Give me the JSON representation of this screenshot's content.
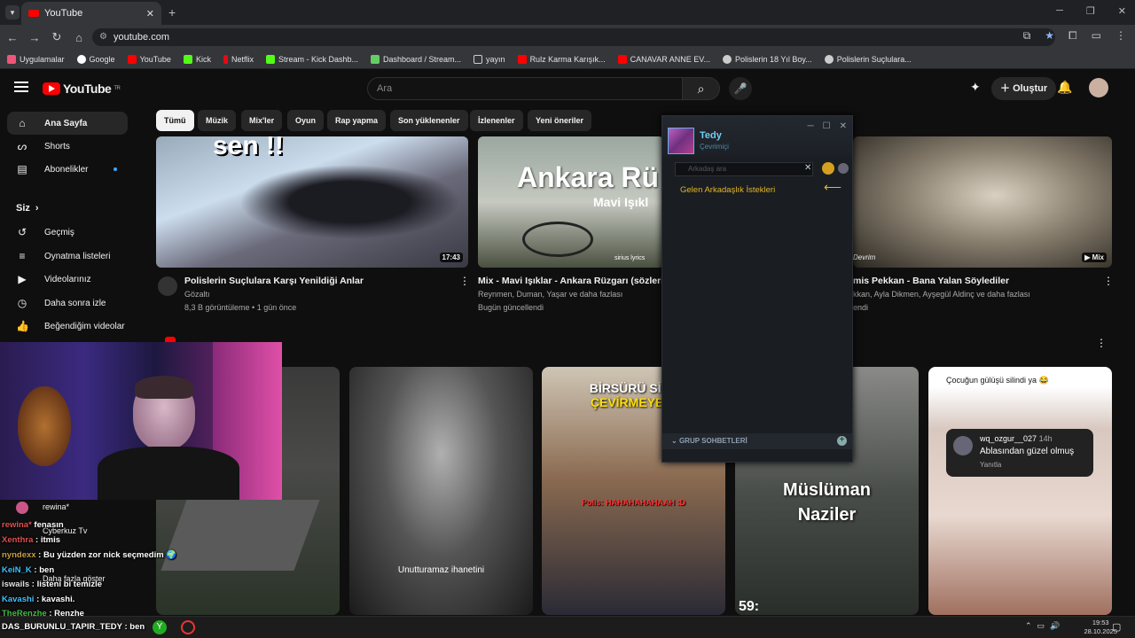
{
  "browser": {
    "tab_title": "YouTube",
    "url": "youtube.com",
    "bookmarks": [
      "Uygulamalar",
      "Google",
      "YouTube",
      "Kick",
      "Netflix",
      "Stream - Kick Dashb...",
      "Dashboard / Stream...",
      "yayın",
      "Rulz Karma Karışık...",
      "CANAVAR ANNE EV...",
      "Polislerin 18 Yıl Boy...",
      "Polislerin Suçlulara..."
    ]
  },
  "youtube": {
    "logo": "YouTube",
    "logo_sup": "TR",
    "search_placeholder": "Ara",
    "create_label": "Oluştur",
    "sidebar": {
      "home": "Ana Sayfa",
      "shorts": "Shorts",
      "subs": "Abonelikler",
      "you": "Siz",
      "history": "Geçmiş",
      "playlists": "Oynatma listeleri",
      "videos": "Videolarınız",
      "watch_later": "Daha sonra izle",
      "liked": "Beğendiğim videolar",
      "sub_channel1": "rewina*",
      "sub_channel2": "Cyberkuz Tv",
      "show_more": "Daha fazla göster"
    },
    "chips": [
      "Tümü",
      "Müzik",
      "Mix'ler",
      "Oyun",
      "Rap yapma",
      "Son yüklenenler",
      "İzlenenler",
      "Yeni öneriler"
    ],
    "videos": [
      {
        "title": "Polislerin Suçlulara Karşı Yenildiği Anlar",
        "channel": "Gözaltı",
        "meta": "8,3 B görüntüleme • 1 gün önce",
        "duration": "17:43",
        "thumb_text": "sen !!"
      },
      {
        "title": "Mix - Mavi Işıklar - Ankara Rüzgarı (sözleri/l",
        "channel": "Reynmen, Duman, Yaşar ve daha fazlası",
        "meta": "Bugün güncellendi",
        "thumb_text": "Ankara Rü",
        "thumb_sub": "Mavi Işıkl",
        "thumb_credit": "sirius lyrics"
      },
      {
        "title": "mis Pekkan - Bana Yalan Söylediler",
        "channel": "kkan, Ayla Dikmen, Ayşegül Aldinç ve daha fazlası",
        "meta": "endi",
        "badge": "Mix",
        "thumb_credit": "Devrim"
      }
    ],
    "shorts": [
      {
        "text": ""
      },
      {
        "text": "Unutturamaz ihanetini"
      },
      {
        "text": "BİRSÜRÜ SİLA",
        "text2": "ÇEVİRMEYE G",
        "caption": "Polis: HAHAHAHAHAAH :D"
      },
      {
        "text": "Müslüman",
        "text2": "Naziler",
        "counter": "59:"
      },
      {
        "header": "Çocuğun gülüşü silindi ya 😂",
        "comment_user": "wq_ozgur__027",
        "comment_time": "14h",
        "comment_text": "Ablasından güzel olmuş",
        "reply": "Yanıtla"
      }
    ]
  },
  "steam": {
    "user_name": "Tedy",
    "status": "Çevrimiçi",
    "search_placeholder": "Arkadaş ara",
    "incoming_requests": "Gelen Arkadaşlık İstekleri",
    "groups": "GRUP SOHBETLERİ"
  },
  "chat": [
    {
      "user": "rewina*",
      "msg": " fenasın",
      "color": "#e05050"
    },
    {
      "user": "Xenthra",
      "msg": " : itmis",
      "color": "#e05050"
    },
    {
      "user": "nyndexx",
      "msg": " : Bu yüzden zor nick seçmedim 🌍",
      "color": "#c8a040"
    },
    {
      "user": "KeiN_K",
      "msg": " : ben",
      "color": "#40c0ff"
    },
    {
      "user": "iswails",
      "msg": " : listeni bi temizle",
      "color": "#e0e0e0"
    },
    {
      "user": "Kavashi",
      "msg": " : kavashi.",
      "color": "#40c0ff"
    },
    {
      "user": "TheRenzhe",
      "msg": " : Renzhe",
      "color": "#40c040"
    },
    {
      "user": "DAS_BURUNLU_TAPIR_TEDY",
      "msg": " : ben",
      "color": "#e0e0e0"
    }
  ],
  "taskbar": {
    "time": "19:53",
    "date": "28.10.2025"
  },
  "colors": {
    "yt_red": "#ff0000",
    "steam_blue": "#6dcff6",
    "steam_gold": "#e3b72a"
  }
}
